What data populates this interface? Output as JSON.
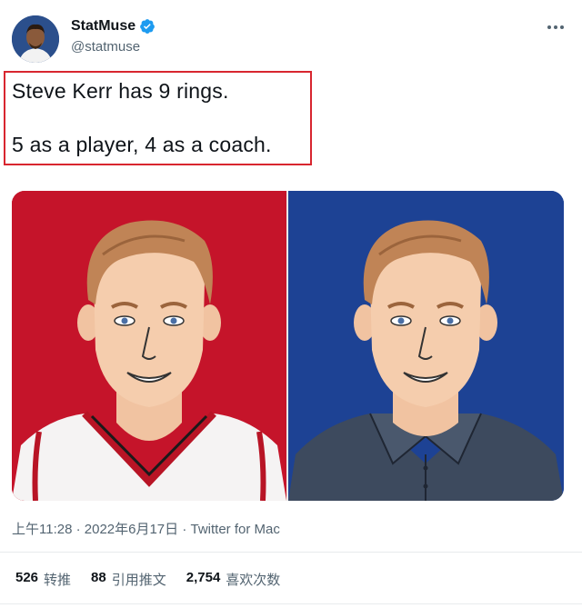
{
  "tweet": {
    "author": {
      "display_name": "StatMuse",
      "handle": "@statmuse",
      "verified": true,
      "avatar_icon": "avatar-image"
    },
    "text_line1": "Steve Kerr has 9 rings.",
    "text_line2": "5 as a player, 4 as a coach.",
    "media": {
      "left_background": "#c5142a",
      "right_background": "#1d4294"
    },
    "meta": "上午11:28 · 2022年6月17日 · Twitter for Mac",
    "stats": [
      {
        "count": "526",
        "label": "转推"
      },
      {
        "count": "88",
        "label": "引用推文"
      },
      {
        "count": "2,754",
        "label": "喜欢次数"
      }
    ]
  },
  "colors": {
    "verified_badge": "#1d9bf0",
    "highlight_border": "#d8262f",
    "secondary_text": "#536471"
  }
}
